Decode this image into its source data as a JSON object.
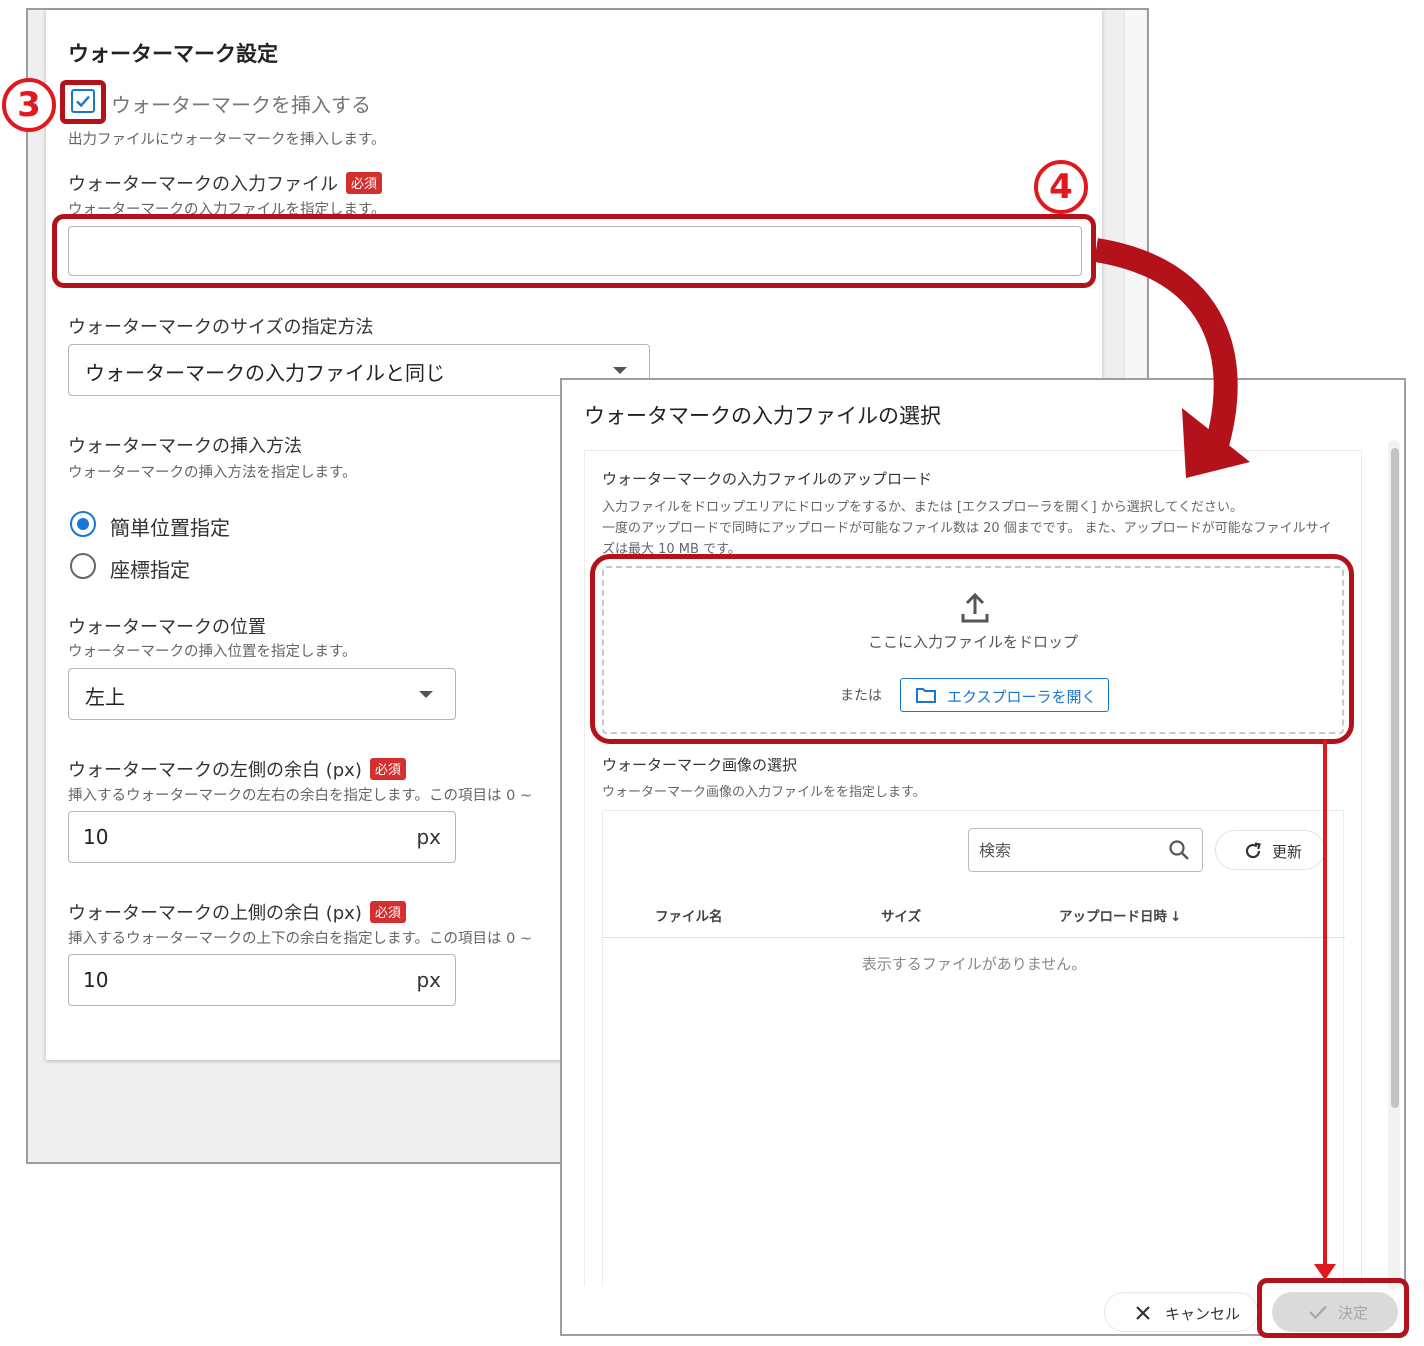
{
  "settings": {
    "section_title": "ウォーターマーク設定",
    "insert_checkbox": {
      "label": "ウォーターマークを挿入する",
      "checked": true
    },
    "insert_desc": "出力ファイルにウォーターマークを挿入します。",
    "input_file": {
      "label": "ウォーターマークの入力ファイル",
      "required_badge": "必須",
      "desc": "ウォーターマークの入力ファイルを指定します。",
      "value": ""
    },
    "size_method": {
      "label": "ウォーターマークのサイズの指定方法",
      "selected": "ウォーターマークの入力ファイルと同じ"
    },
    "insert_method": {
      "label": "ウォーターマークの挿入方法",
      "desc": "ウォーターマークの挿入方法を指定します。",
      "options": [
        {
          "label": "簡単位置指定",
          "selected": true
        },
        {
          "label": "座標指定",
          "selected": false
        }
      ]
    },
    "position": {
      "label": "ウォーターマークの位置",
      "desc": "ウォーターマークの挿入位置を指定します。",
      "selected": "左上"
    },
    "left_margin": {
      "label": "ウォーターマークの左側の余白 (px)",
      "required_badge": "必須",
      "desc": "挿入するウォーターマークの左右の余白を指定します。この項目は 0 ~",
      "value": "10",
      "unit": "px"
    },
    "top_margin": {
      "label": "ウォーターマークの上側の余白 (px)",
      "required_badge": "必須",
      "desc": "挿入するウォーターマークの上下の余白を指定します。この項目は 0 ~",
      "value": "10",
      "unit": "px"
    }
  },
  "dialog": {
    "title": "ウォータマークの入力ファイルの選択",
    "upload": {
      "heading": "ウォーターマークの入力ファイルのアップロード",
      "desc_lines": [
        "入力ファイルをドロップエリアにドロップをするか、または [エクスプローラを開く] から選択してください。",
        "一度のアップロードで同時にアップロードが可能なファイル数は 20 個までです。 また、アップロードが可能なファイルサイ",
        "ズは最大 10 MB です。"
      ],
      "drop_text": "ここに入力ファイルをドロップ",
      "or_text": "または",
      "explorer_button": "エクスプローラを開く"
    },
    "image_select": {
      "heading": "ウォーターマーク画像の選択",
      "desc": "ウォーターマーク画像の入力ファイルをを指定します。",
      "search_placeholder": "検索",
      "refresh_button": "更新",
      "columns": [
        "ファイル名",
        "サイズ",
        "アップロード日時"
      ],
      "sort_indicator": "↓",
      "empty_message": "表示するファイルがありません。"
    },
    "cancel_button": "キャンセル",
    "ok_button": "決定",
    "ok_enabled": false
  },
  "annotations": {
    "step3": "3",
    "step4": "4",
    "highlight_color": "#b3121a",
    "step_color": "#e0191e"
  },
  "colors": {
    "accent": "#1976d2",
    "required_badge": "#d32f2f",
    "disabled_button": "#dadada"
  }
}
